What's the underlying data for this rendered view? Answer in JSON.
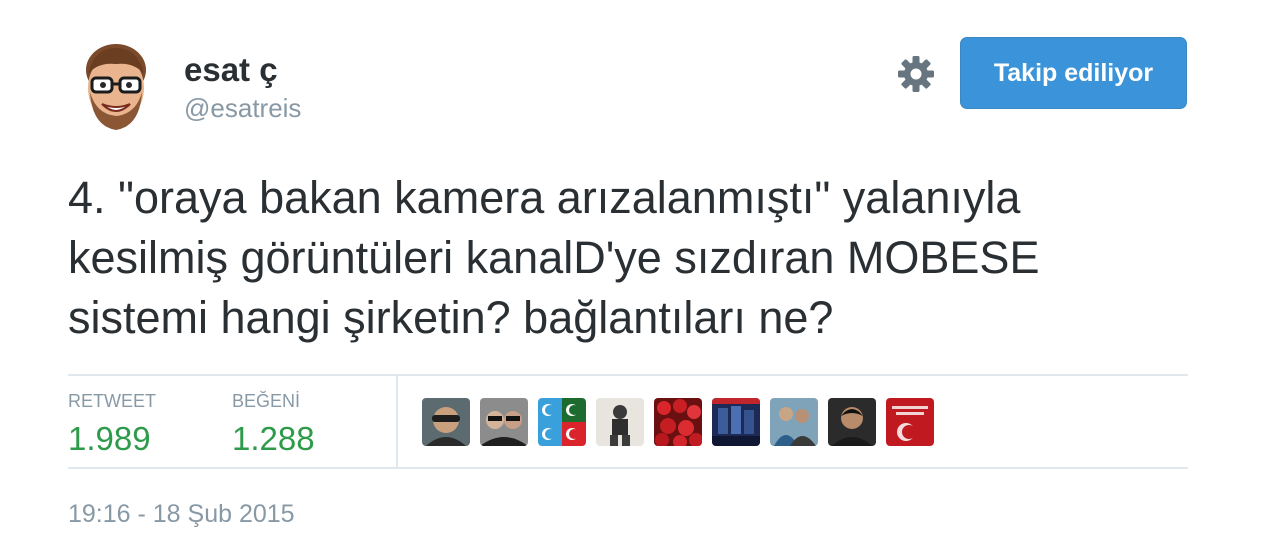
{
  "user": {
    "display_name": "esat ç",
    "username": "@esatreis"
  },
  "follow_button": {
    "label": "Takip ediliyor",
    "color": "#3b94d9"
  },
  "settings_icon": "gear-icon",
  "tweet": {
    "text": "4. \"oraya bakan kamera arızalanmıştı\" yalanıyla\nkesilmiş görüntüleri kanalD'ye sızdıran MOBESE\nsistemi hangi şirketin? bağlantıları ne?"
  },
  "stats": {
    "retweet_label": "RETWEET",
    "retweet_count": "1.989",
    "likes_label": "BEĞENİ",
    "likes_count": "1.288",
    "count_color": "#2e9b4b"
  },
  "likers": [
    {
      "name": "liker-avatar-1"
    },
    {
      "name": "liker-avatar-2"
    },
    {
      "name": "liker-avatar-3"
    },
    {
      "name": "liker-avatar-4"
    },
    {
      "name": "liker-avatar-5"
    },
    {
      "name": "liker-avatar-6"
    },
    {
      "name": "liker-avatar-7"
    },
    {
      "name": "liker-avatar-8"
    },
    {
      "name": "liker-avatar-9"
    }
  ],
  "timestamp": "19:16 - 18 Şub 2015"
}
